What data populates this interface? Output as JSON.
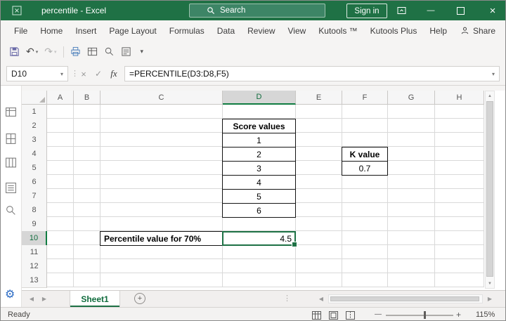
{
  "colors": {
    "titlebar_green": "#1f7145",
    "accent_green": "#107c41",
    "selection_green": "#1e7145",
    "gear_blue": "#2b6bc4"
  },
  "title_bar": {
    "title": "percentile  -  Excel",
    "search_label": "Search",
    "sign_in_label": "Sign in"
  },
  "menu_bar": {
    "tabs": [
      "File",
      "Home",
      "Insert",
      "Page Layout",
      "Formulas",
      "Data",
      "Review",
      "View",
      "Kutools ™",
      "Kutools Plus",
      "Help"
    ],
    "share_label": "Share"
  },
  "formula_bar": {
    "name_box_value": "D10",
    "cancel_glyph": "×",
    "enter_glyph": "✓",
    "fx_label": "fx",
    "formula": "=PERCENTILE(D3:D8,F5)"
  },
  "grid": {
    "column_headers": [
      "A",
      "B",
      "C",
      "D",
      "E",
      "F",
      "G",
      "H"
    ],
    "row_headers": [
      "1",
      "2",
      "3",
      "4",
      "5",
      "6",
      "7",
      "8",
      "9",
      "10",
      "11",
      "12",
      "13"
    ],
    "selected_column": "D",
    "selected_row": "10",
    "cells": {
      "d2": "Score values",
      "d3": "1",
      "d4": "2",
      "d5": "3",
      "d6": "4",
      "d7": "5",
      "d8": "6",
      "f4": "K value",
      "f5": "0.7",
      "c10": "Percentile value for 70%",
      "d10": "4.5"
    }
  },
  "sheet_bar": {
    "active_tab": "Sheet1",
    "add_sheet_glyph": "+"
  },
  "status_bar": {
    "mode": "Ready",
    "zoom_level": "115%",
    "zoom_out_glyph": "—",
    "zoom_in_glyph": "+"
  },
  "icons": {
    "dropdown": "▾",
    "vdots": "⋮",
    "undo": "↶",
    "redo": "↷",
    "up": "▲",
    "down": "▼",
    "left": "◀",
    "right": "▶",
    "minus": "—",
    "close": "×",
    "gear": "⚙"
  }
}
